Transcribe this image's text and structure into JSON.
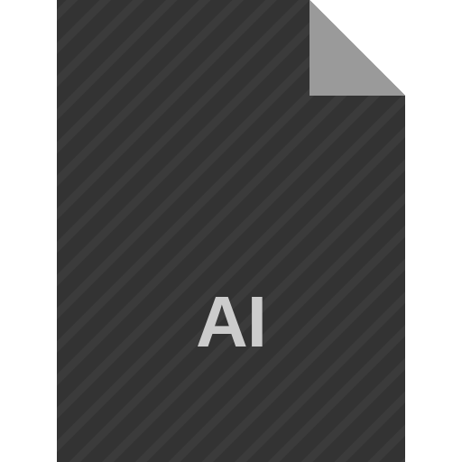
{
  "file_type": {
    "label": "AI",
    "icon": "document-file-icon"
  },
  "colors": {
    "body": "#333333",
    "stripe": "#3b3b3b",
    "fold": "#9a9a9a",
    "label": "#cccccc",
    "background": "#ffffff"
  }
}
